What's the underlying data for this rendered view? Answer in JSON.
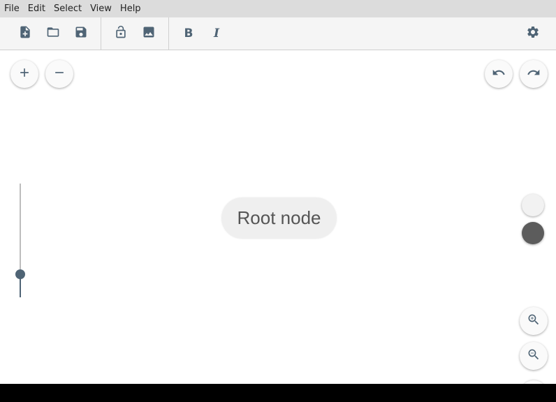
{
  "menubar": {
    "items": [
      {
        "label": "File"
      },
      {
        "label": "Edit"
      },
      {
        "label": "Select"
      },
      {
        "label": "View"
      },
      {
        "label": "Help"
      }
    ]
  },
  "toolbar": {
    "buttons": [
      {
        "icon": "new-file-icon"
      },
      {
        "icon": "open-folder-icon"
      },
      {
        "icon": "save-icon"
      },
      {
        "icon": "unlock-icon"
      },
      {
        "icon": "image-icon"
      },
      {
        "icon": "bold-icon",
        "label": "B"
      },
      {
        "icon": "italic-icon",
        "label": "I"
      },
      {
        "icon": "gear-icon"
      }
    ]
  },
  "canvas": {
    "root_node_label": "Root node",
    "slider_level_fraction": 0.2,
    "swatches": [
      {
        "name": "light",
        "color": "#f2f2f2"
      },
      {
        "name": "dark",
        "color": "#5c5c5c"
      }
    ]
  },
  "colors": {
    "accent": "#4f6475",
    "menubar": "#dcdcdc",
    "toolbar": "#f5f5f5"
  }
}
